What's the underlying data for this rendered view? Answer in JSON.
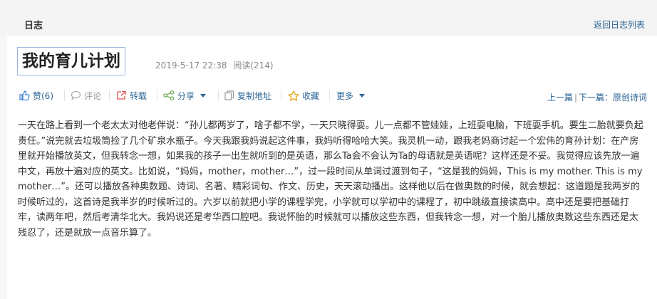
{
  "topbar": {
    "title": "日志",
    "back_link": "返回日志列表"
  },
  "post": {
    "title": "我的育儿计划",
    "date": "2019-5-17 22:38",
    "reads": "阅读(214)"
  },
  "toolbar": {
    "like": "赞(6)",
    "comment": "评论",
    "repost": "转载",
    "share": "分享",
    "copy_link": "复制地址",
    "favorite": "收藏",
    "more": "更多",
    "prev": "上一篇",
    "next": "下一篇：原创诗词",
    "separator": "|"
  },
  "article": {
    "text": "一天在路上看到一个老太太对他老伴说：“孙儿都两岁了，啥子都不学，一天只晓得耍。儿一点都不管娃娃，上班耍电脑，下班耍手机。要生二胎就要负起责任。”说完就去垃圾筒捡了几个矿泉水瓶子。今天我跟我妈说起这件事，我妈听得哈哈大笑。我灵机一动，跟我老妈商讨起一个宏伟的育孙计划：在产房里就开始播放英文，但我转念一想，如果我的孩子一出生就听到的是英语，那么Ta会不会认为Ta的母语就是英语呢？这样还是不妥。我觉得应该先放一遍中文，再放十遍对应的英文。比如说，“妈妈，mother，mother…”，过一段时间从单词过渡到句子，“这是我的妈妈，This is my mother. This is my mother…”。还可以播放各种奥数题、诗词、名著、精彩词句、作文、历史，天天滚动播出。这样他以后在做奥数的时候，就会想起：这道题是我两岁的时候听过的，这首诗是我半岁的时候听过的。六岁以前就把小学的课程学完，小学就可以学初中的课程了，初中跳级直接读高中。高中还是要把基础打牢，读两年吧，然后考清华北大。我妈说还是考华西口腔吧。我说怀胎的时候就可以播放这些东西，但我转念一想，对一个胎儿播放奥数这些东西还是太残忍了，还是就放一点音乐算了。"
  },
  "colors": {
    "link": "#2a6496",
    "icon_blue": "#3b7bd4",
    "icon_red": "#e0524f",
    "icon_green": "#6aa84f",
    "icon_gold": "#e8a317"
  }
}
